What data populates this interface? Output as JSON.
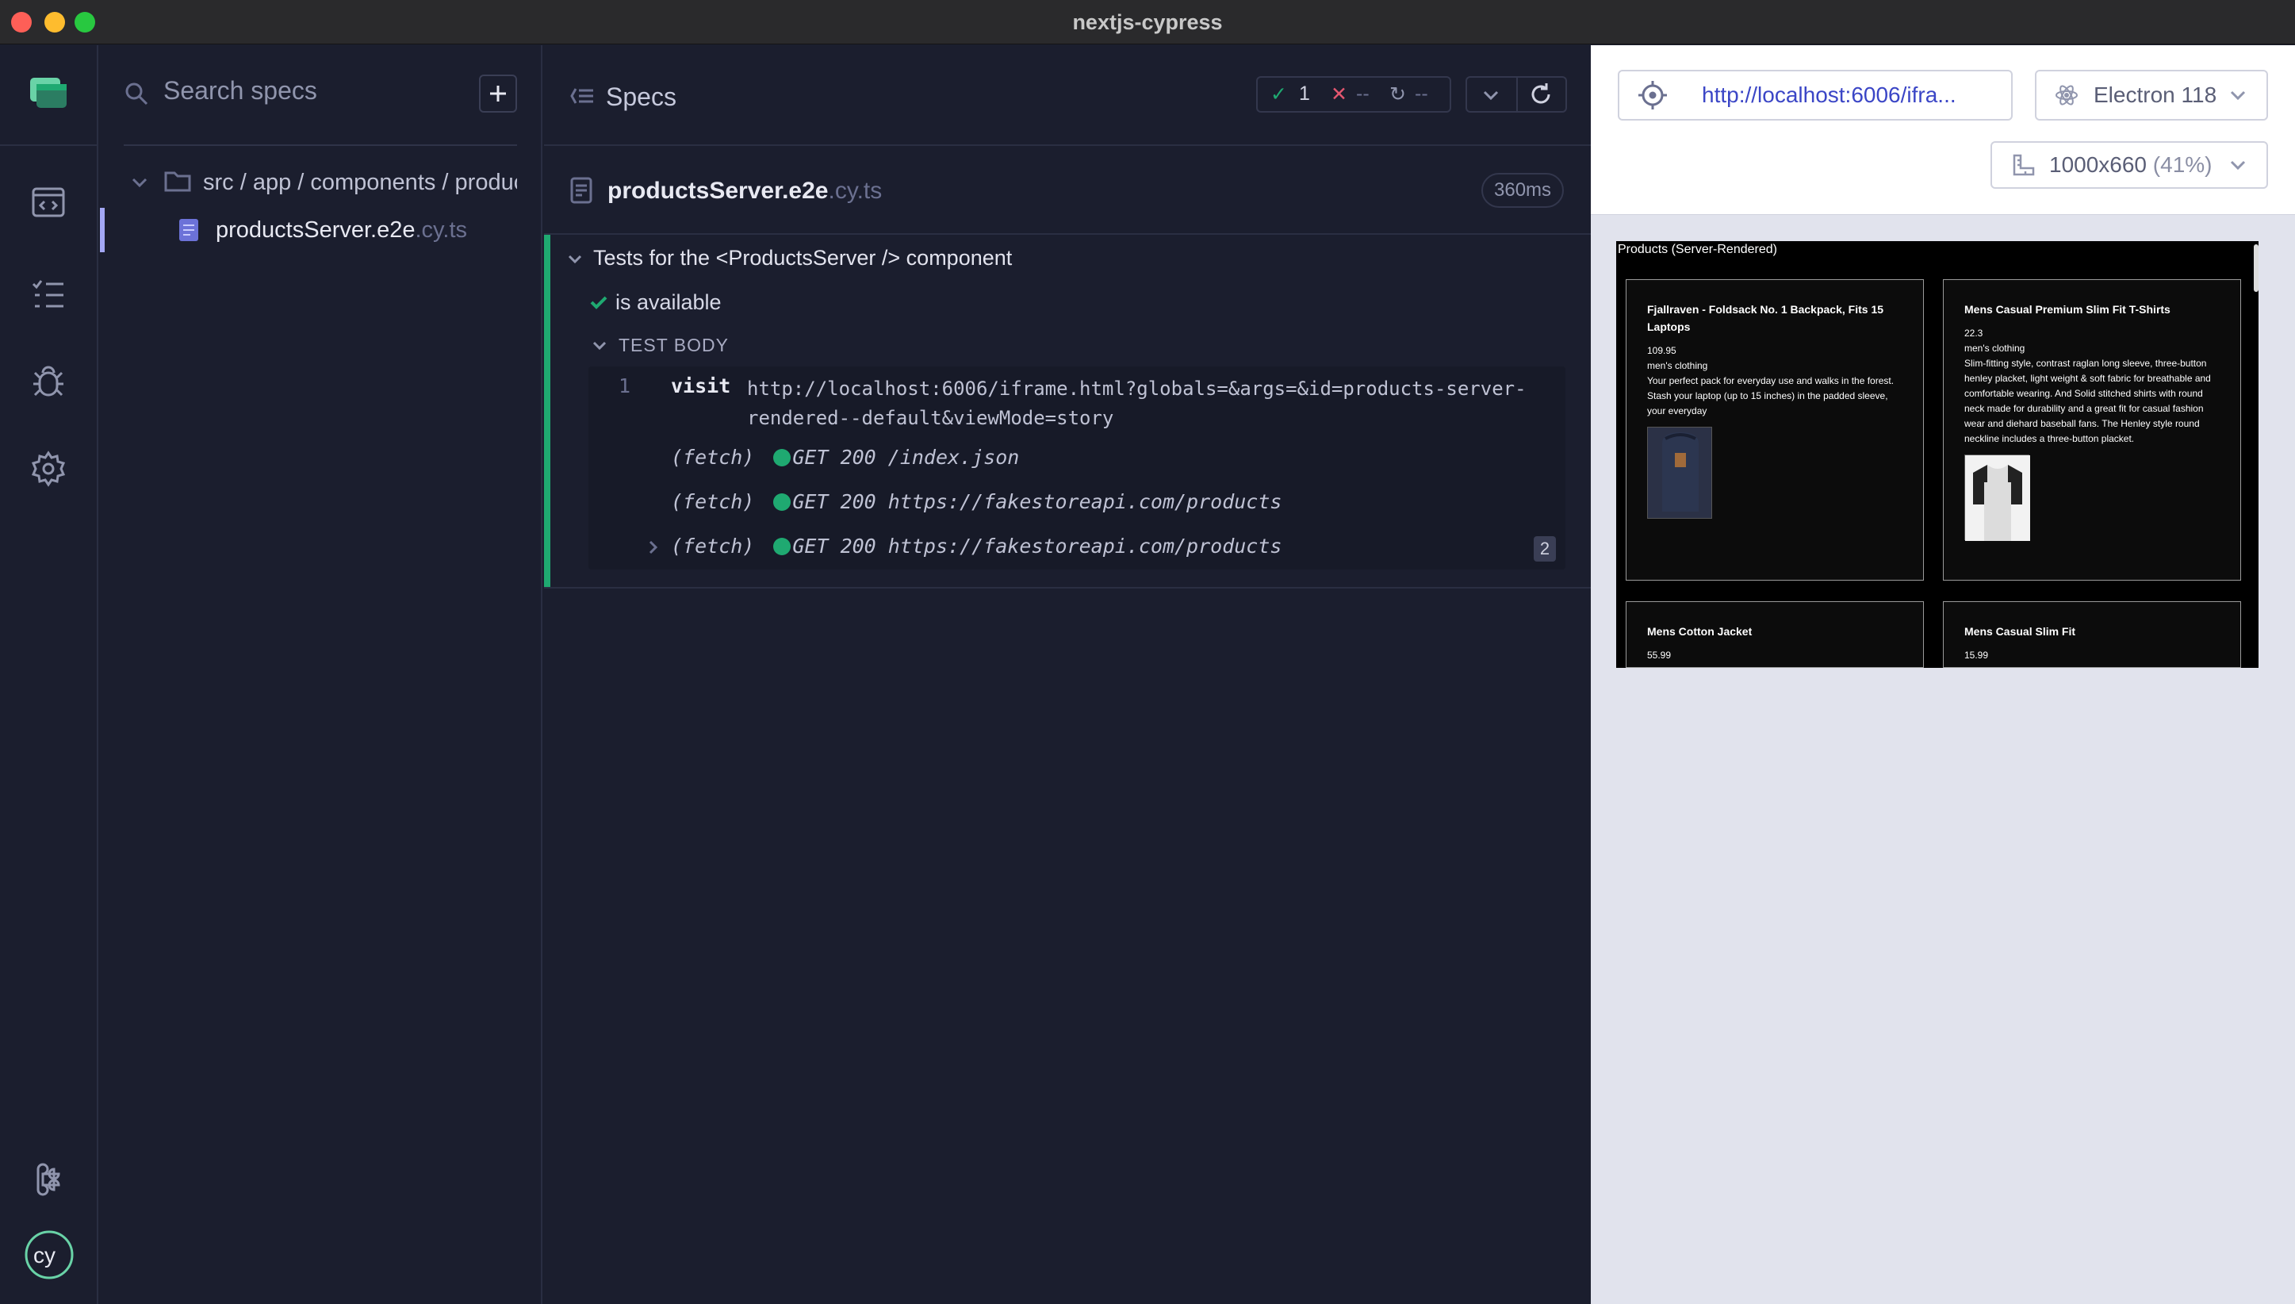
{
  "window": {
    "title": "nextjs-cypress"
  },
  "sidebar": {
    "search_placeholder": "Search specs",
    "folder_path": "src / app / components / products",
    "file_name": "productsServer.e2e",
    "file_ext": ".cy.ts"
  },
  "reporter": {
    "header_title": "Specs",
    "stats": {
      "passed": "1",
      "failed": "--",
      "pending": "--"
    },
    "spec_name": "productsServer.e2e",
    "spec_ext": ".cy.ts",
    "duration": "360ms",
    "suite_title": "Tests for the <ProductsServer /> component",
    "test_title": "is available",
    "body_title": "TEST BODY",
    "commands": [
      {
        "num": "1",
        "name": "visit",
        "message": "http://localhost:6006/iframe.html?globals=&args=&id=products-server-rendered--default&viewMode=story"
      }
    ],
    "fetches": [
      {
        "label": "(fetch)",
        "message": "GET 200 /index.json"
      },
      {
        "label": "(fetch)",
        "message": "GET 200 https://fakestoreapi.com/products"
      },
      {
        "label": "(fetch)",
        "message": "GET 200 https://fakestoreapi.com/products",
        "count": "2"
      }
    ]
  },
  "aut": {
    "url": "http://localhost:6006/ifra...",
    "browser": "Electron 118",
    "viewport": "1000x660",
    "viewport_scale": "(41%)",
    "page": {
      "title": "Products (Server-Rendered)",
      "products": [
        {
          "title": "Fjallraven - Foldsack No. 1 Backpack, Fits 15 Laptops",
          "price": "109.95",
          "category": "men's clothing",
          "description": "Your perfect pack for everyday use and walks in the forest. Stash your laptop (up to 15 inches) in the padded sleeve, your everyday"
        },
        {
          "title": "Mens Casual Premium Slim Fit T-Shirts",
          "price": "22.3",
          "category": "men's clothing",
          "description": "Slim-fitting style, contrast raglan long sleeve, three-button henley placket, light weight & soft fabric for breathable and comfortable wearing. And Solid stitched shirts with round neck made for durability and a great fit for casual fashion wear and diehard baseball fans. The Henley style round neckline includes a three-button placket."
        },
        {
          "title": "Mens Cotton Jacket",
          "price": "55.99"
        },
        {
          "title": "Mens Casual Slim Fit",
          "price": "15.99"
        }
      ]
    }
  },
  "colors": {
    "pass": "#1fa971",
    "fail": "#e45770",
    "accent": "#a3a7f4",
    "link": "#3b46c6"
  },
  "icons": [
    "runs-icon",
    "specs-icon",
    "debug-icon",
    "settings-icon",
    "command-icon",
    "cypress-logo"
  ]
}
